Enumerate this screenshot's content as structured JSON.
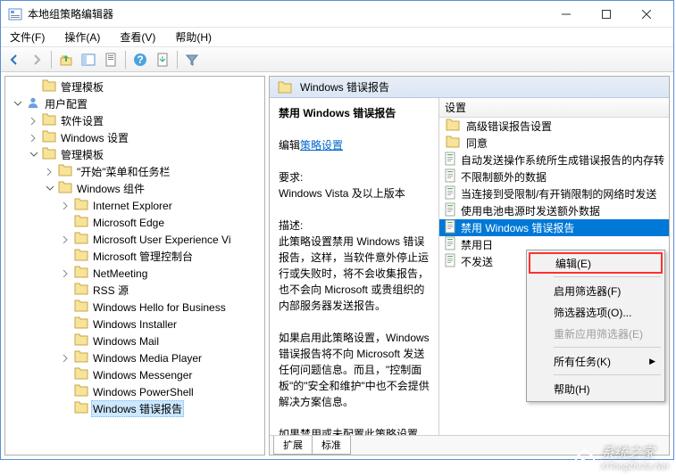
{
  "window": {
    "title": "本地组策略编辑器"
  },
  "menubar": [
    "文件(F)",
    "操作(A)",
    "查看(V)",
    "帮助(H)"
  ],
  "tree": [
    {
      "depth": 1,
      "expander": "none",
      "label": "管理模板",
      "sel": false
    },
    {
      "depth": 0,
      "expander": "open",
      "label": "用户配置",
      "sel": false,
      "icon": "user"
    },
    {
      "depth": 1,
      "expander": "closed",
      "label": "软件设置",
      "sel": false
    },
    {
      "depth": 1,
      "expander": "closed",
      "label": "Windows 设置",
      "sel": false
    },
    {
      "depth": 1,
      "expander": "open",
      "label": "管理模板",
      "sel": false
    },
    {
      "depth": 2,
      "expander": "closed",
      "label": "\"开始\"菜单和任务栏",
      "sel": false
    },
    {
      "depth": 2,
      "expander": "open",
      "label": "Windows 组件",
      "sel": false
    },
    {
      "depth": 3,
      "expander": "closed",
      "label": "Internet Explorer",
      "sel": false
    },
    {
      "depth": 3,
      "expander": "none",
      "label": "Microsoft Edge",
      "sel": false
    },
    {
      "depth": 3,
      "expander": "closed",
      "label": "Microsoft User Experience Vi",
      "sel": false
    },
    {
      "depth": 3,
      "expander": "none",
      "label": "Microsoft 管理控制台",
      "sel": false
    },
    {
      "depth": 3,
      "expander": "closed",
      "label": "NetMeeting",
      "sel": false
    },
    {
      "depth": 3,
      "expander": "none",
      "label": "RSS 源",
      "sel": false
    },
    {
      "depth": 3,
      "expander": "none",
      "label": "Windows Hello for Business",
      "sel": false
    },
    {
      "depth": 3,
      "expander": "none",
      "label": "Windows Installer",
      "sel": false
    },
    {
      "depth": 3,
      "expander": "none",
      "label": "Windows Mail",
      "sel": false
    },
    {
      "depth": 3,
      "expander": "closed",
      "label": "Windows Media Player",
      "sel": false
    },
    {
      "depth": 3,
      "expander": "none",
      "label": "Windows Messenger",
      "sel": false
    },
    {
      "depth": 3,
      "expander": "none",
      "label": "Windows PowerShell",
      "sel": false
    },
    {
      "depth": 3,
      "expander": "none",
      "label": "Windows 错误报告",
      "sel": true
    }
  ],
  "right": {
    "header": "Windows 错误报告",
    "detail": {
      "title": "禁用 Windows 错误报告",
      "edit_link_prefix": "编辑",
      "edit_link": "策略设置",
      "req_label": "要求:",
      "req_value": "Windows Vista 及以上版本",
      "desc_label": "描述:",
      "desc_p1": "此策略设置禁用 Windows 错误报告，这样，当软件意外停止运行或失败时，将不会收集报告，也不会向 Microsoft 或贵组织的内部服务器发送报告。",
      "desc_p2": "如果启用此策略设置，Windows 错误报告将不向 Microsoft 发送任何问题信息。而且，\"控制面板\"的\"安全和维护\"中也不会提供解决方案信息。",
      "desc_p3": "如果禁用或未配置此策略设置，则"
    },
    "list_header": "设置",
    "items": [
      {
        "icon": "folder",
        "label": "高级错误报告设置"
      },
      {
        "icon": "folder",
        "label": "同意"
      },
      {
        "icon": "setting",
        "label": "自动发送操作系统所生成错误报告的内存转"
      },
      {
        "icon": "setting",
        "label": "不限制额外的数据"
      },
      {
        "icon": "setting",
        "label": "当连接到受限制/有开销限制的网络时发送"
      },
      {
        "icon": "setting",
        "label": "使用电池电源时发送额外数据"
      },
      {
        "icon": "setting",
        "label": "禁用 Windows 错误报告",
        "highlighted": true
      },
      {
        "icon": "setting",
        "label": "禁用日"
      },
      {
        "icon": "setting",
        "label": "不发送"
      }
    ],
    "tabs": [
      "扩展",
      "标准"
    ]
  },
  "context_menu": [
    {
      "label": "编辑(E)",
      "type": "item",
      "highlight": true
    },
    {
      "type": "sep"
    },
    {
      "label": "启用筛选器(F)",
      "type": "item"
    },
    {
      "label": "筛选器选项(O)...",
      "type": "item"
    },
    {
      "label": "重新应用筛选器(E)",
      "type": "item",
      "disabled": true
    },
    {
      "type": "sep"
    },
    {
      "label": "所有任务(K)",
      "type": "item",
      "arrow": true
    },
    {
      "type": "sep"
    },
    {
      "label": "帮助(H)",
      "type": "item"
    }
  ],
  "watermark": {
    "line1": "系统之家",
    "line2": "XiTongZhiJia.Net"
  }
}
